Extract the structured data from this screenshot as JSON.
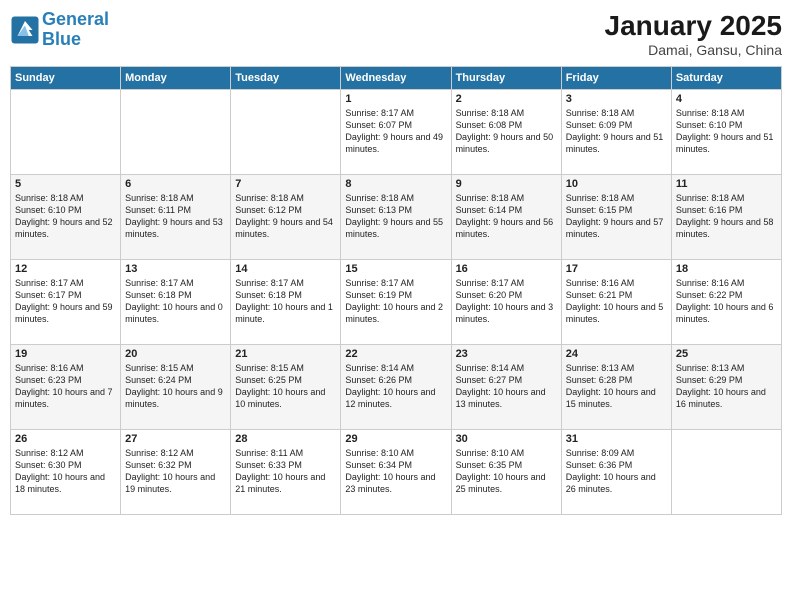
{
  "header": {
    "logo_line1": "General",
    "logo_line2": "Blue",
    "month_title": "January 2025",
    "location": "Damai, Gansu, China"
  },
  "days_of_week": [
    "Sunday",
    "Monday",
    "Tuesday",
    "Wednesday",
    "Thursday",
    "Friday",
    "Saturday"
  ],
  "weeks": [
    [
      {
        "day": "",
        "info": ""
      },
      {
        "day": "",
        "info": ""
      },
      {
        "day": "",
        "info": ""
      },
      {
        "day": "1",
        "info": "Sunrise: 8:17 AM\nSunset: 6:07 PM\nDaylight: 9 hours and 49 minutes."
      },
      {
        "day": "2",
        "info": "Sunrise: 8:18 AM\nSunset: 6:08 PM\nDaylight: 9 hours and 50 minutes."
      },
      {
        "day": "3",
        "info": "Sunrise: 8:18 AM\nSunset: 6:09 PM\nDaylight: 9 hours and 51 minutes."
      },
      {
        "day": "4",
        "info": "Sunrise: 8:18 AM\nSunset: 6:10 PM\nDaylight: 9 hours and 51 minutes."
      }
    ],
    [
      {
        "day": "5",
        "info": "Sunrise: 8:18 AM\nSunset: 6:10 PM\nDaylight: 9 hours and 52 minutes."
      },
      {
        "day": "6",
        "info": "Sunrise: 8:18 AM\nSunset: 6:11 PM\nDaylight: 9 hours and 53 minutes."
      },
      {
        "day": "7",
        "info": "Sunrise: 8:18 AM\nSunset: 6:12 PM\nDaylight: 9 hours and 54 minutes."
      },
      {
        "day": "8",
        "info": "Sunrise: 8:18 AM\nSunset: 6:13 PM\nDaylight: 9 hours and 55 minutes."
      },
      {
        "day": "9",
        "info": "Sunrise: 8:18 AM\nSunset: 6:14 PM\nDaylight: 9 hours and 56 minutes."
      },
      {
        "day": "10",
        "info": "Sunrise: 8:18 AM\nSunset: 6:15 PM\nDaylight: 9 hours and 57 minutes."
      },
      {
        "day": "11",
        "info": "Sunrise: 8:18 AM\nSunset: 6:16 PM\nDaylight: 9 hours and 58 minutes."
      }
    ],
    [
      {
        "day": "12",
        "info": "Sunrise: 8:17 AM\nSunset: 6:17 PM\nDaylight: 9 hours and 59 minutes."
      },
      {
        "day": "13",
        "info": "Sunrise: 8:17 AM\nSunset: 6:18 PM\nDaylight: 10 hours and 0 minutes."
      },
      {
        "day": "14",
        "info": "Sunrise: 8:17 AM\nSunset: 6:18 PM\nDaylight: 10 hours and 1 minute."
      },
      {
        "day": "15",
        "info": "Sunrise: 8:17 AM\nSunset: 6:19 PM\nDaylight: 10 hours and 2 minutes."
      },
      {
        "day": "16",
        "info": "Sunrise: 8:17 AM\nSunset: 6:20 PM\nDaylight: 10 hours and 3 minutes."
      },
      {
        "day": "17",
        "info": "Sunrise: 8:16 AM\nSunset: 6:21 PM\nDaylight: 10 hours and 5 minutes."
      },
      {
        "day": "18",
        "info": "Sunrise: 8:16 AM\nSunset: 6:22 PM\nDaylight: 10 hours and 6 minutes."
      }
    ],
    [
      {
        "day": "19",
        "info": "Sunrise: 8:16 AM\nSunset: 6:23 PM\nDaylight: 10 hours and 7 minutes."
      },
      {
        "day": "20",
        "info": "Sunrise: 8:15 AM\nSunset: 6:24 PM\nDaylight: 10 hours and 9 minutes."
      },
      {
        "day": "21",
        "info": "Sunrise: 8:15 AM\nSunset: 6:25 PM\nDaylight: 10 hours and 10 minutes."
      },
      {
        "day": "22",
        "info": "Sunrise: 8:14 AM\nSunset: 6:26 PM\nDaylight: 10 hours and 12 minutes."
      },
      {
        "day": "23",
        "info": "Sunrise: 8:14 AM\nSunset: 6:27 PM\nDaylight: 10 hours and 13 minutes."
      },
      {
        "day": "24",
        "info": "Sunrise: 8:13 AM\nSunset: 6:28 PM\nDaylight: 10 hours and 15 minutes."
      },
      {
        "day": "25",
        "info": "Sunrise: 8:13 AM\nSunset: 6:29 PM\nDaylight: 10 hours and 16 minutes."
      }
    ],
    [
      {
        "day": "26",
        "info": "Sunrise: 8:12 AM\nSunset: 6:30 PM\nDaylight: 10 hours and 18 minutes."
      },
      {
        "day": "27",
        "info": "Sunrise: 8:12 AM\nSunset: 6:32 PM\nDaylight: 10 hours and 19 minutes."
      },
      {
        "day": "28",
        "info": "Sunrise: 8:11 AM\nSunset: 6:33 PM\nDaylight: 10 hours and 21 minutes."
      },
      {
        "day": "29",
        "info": "Sunrise: 8:10 AM\nSunset: 6:34 PM\nDaylight: 10 hours and 23 minutes."
      },
      {
        "day": "30",
        "info": "Sunrise: 8:10 AM\nSunset: 6:35 PM\nDaylight: 10 hours and 25 minutes."
      },
      {
        "day": "31",
        "info": "Sunrise: 8:09 AM\nSunset: 6:36 PM\nDaylight: 10 hours and 26 minutes."
      },
      {
        "day": "",
        "info": ""
      }
    ]
  ]
}
